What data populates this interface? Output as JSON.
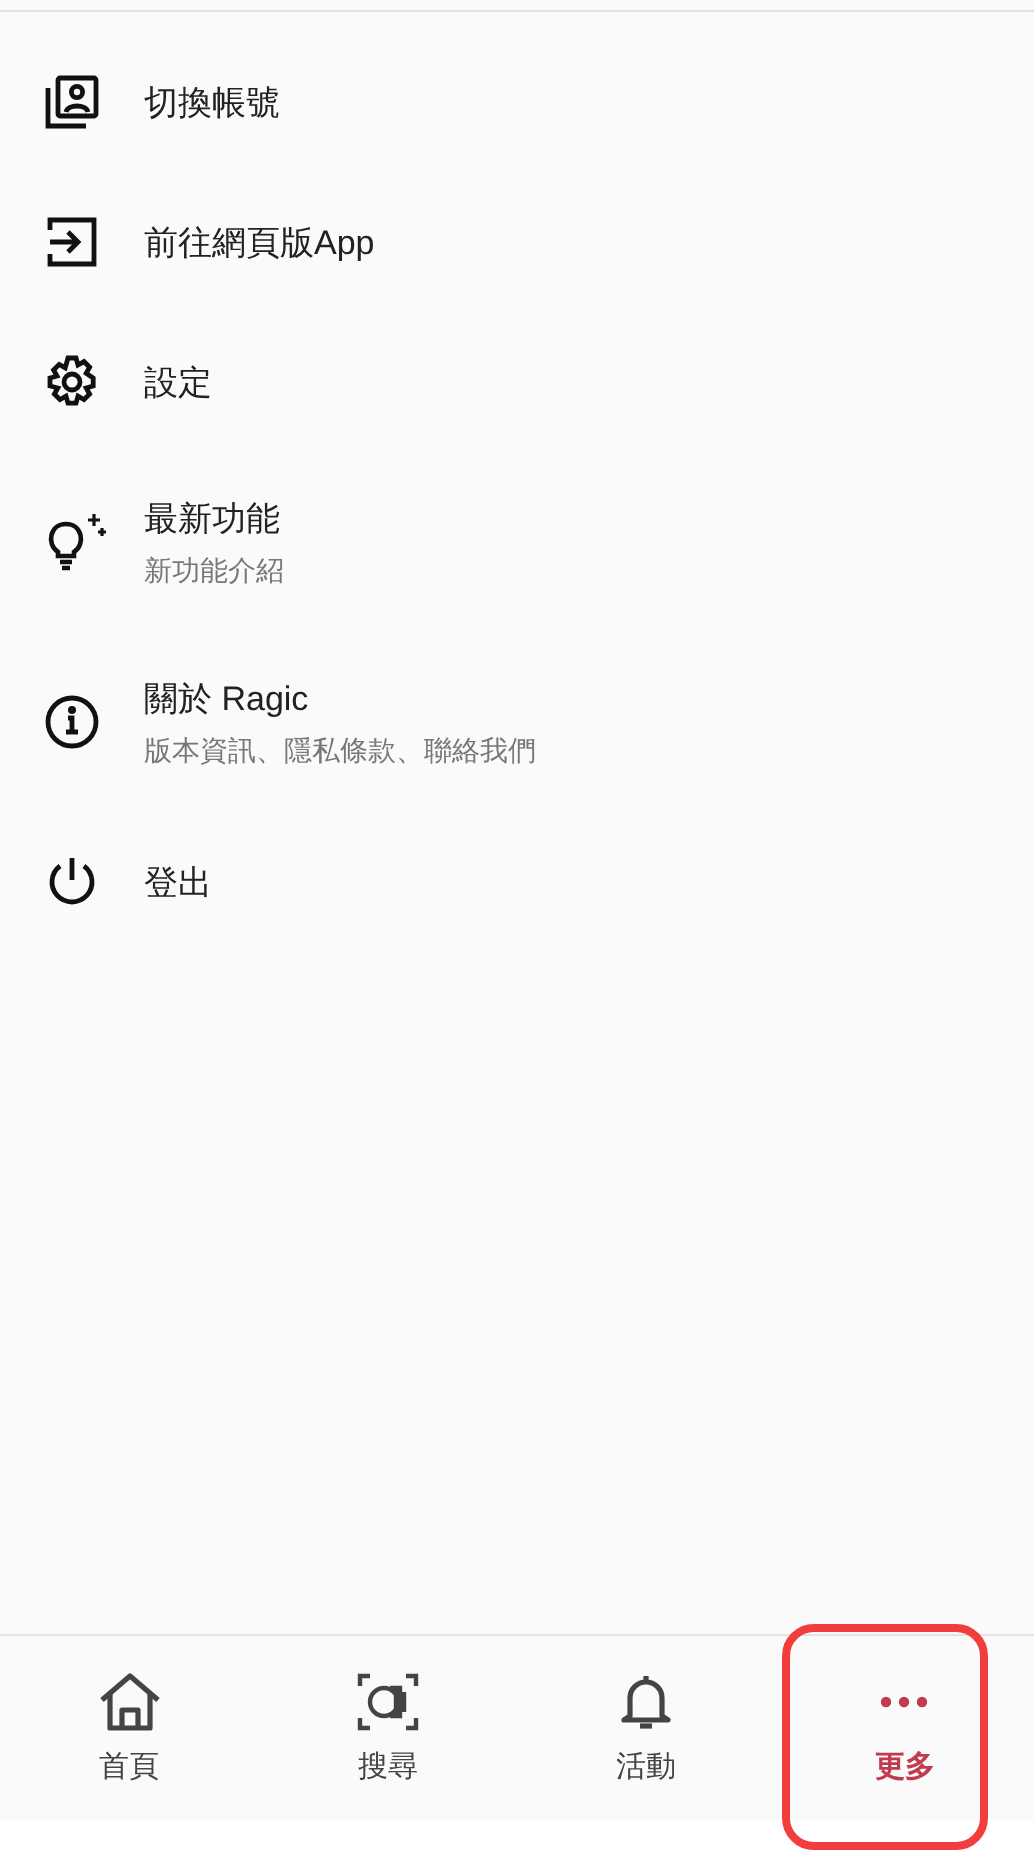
{
  "menu": [
    {
      "kind": "switch-account",
      "label": "切換帳號"
    },
    {
      "kind": "web-app",
      "label": "前往網頁版App"
    },
    {
      "kind": "settings",
      "label": "設定"
    },
    {
      "kind": "new-features",
      "label": "最新功能",
      "subtitle": "新功能介紹"
    },
    {
      "kind": "about",
      "label": "關於 Ragic",
      "subtitle": "版本資訊、隱私條款、聯絡我們"
    },
    {
      "kind": "logout",
      "label": "登出"
    }
  ],
  "bottom_nav": [
    {
      "kind": "home",
      "label": "首頁",
      "selected": false,
      "highlighted": false
    },
    {
      "kind": "search",
      "label": "搜尋",
      "selected": false,
      "highlighted": false
    },
    {
      "kind": "activity",
      "label": "活動",
      "selected": false,
      "highlighted": false
    },
    {
      "kind": "more",
      "label": "更多",
      "selected": true,
      "highlighted": true
    }
  ]
}
